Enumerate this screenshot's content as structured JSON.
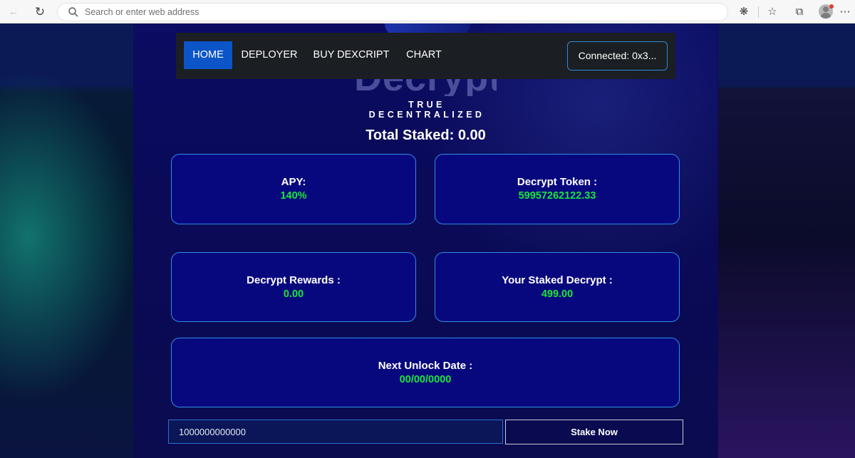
{
  "browser": {
    "address_placeholder": "Search or enter web address",
    "icons": [
      "back-arrow-icon",
      "reload-icon",
      "search-icon",
      "extensions-icon",
      "favorites-icon",
      "collections-icon",
      "profile-icon",
      "more-icon"
    ]
  },
  "brand": {
    "logo_text": "Decrypt",
    "tagline": "TRUE DECENTRALIZED"
  },
  "nav": {
    "items": [
      {
        "label": "HOME",
        "active": true
      },
      {
        "label": "DEPLOYER",
        "active": false
      },
      {
        "label": "BUY DEXCRIPT",
        "active": false
      },
      {
        "label": "CHART",
        "active": false
      }
    ],
    "connect_label": "Connected: 0x3..."
  },
  "stats": {
    "total_staked": "Total Staked: 0.00",
    "apy": {
      "label": "APY:",
      "value": "140%"
    },
    "token": {
      "label": "Decrypt Token :",
      "value": "59957262122.33"
    },
    "rewards": {
      "label": "Decrypt Rewards :",
      "value": "0.00"
    },
    "staked": {
      "label": "Your Staked Decrypt :",
      "value": "499.00"
    },
    "unlock": {
      "label": "Next Unlock Date :",
      "value": "00/00/0000"
    }
  },
  "stake": {
    "amount_value": "1000000000000",
    "button_label": "Stake Now"
  },
  "colors": {
    "accent_blue": "#0b55c8",
    "card_border": "#2f8de6",
    "value_green": "#17e83a"
  }
}
